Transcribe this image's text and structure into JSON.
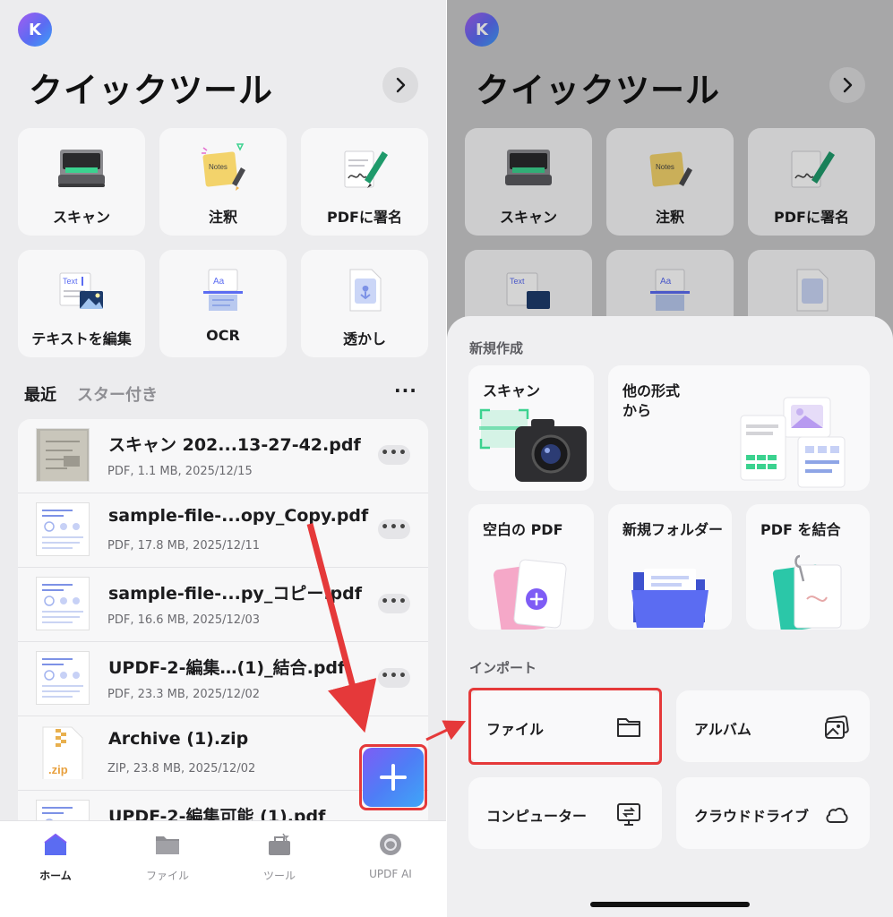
{
  "header": {
    "avatar_initial": "K",
    "title": "クイックツール"
  },
  "tools": [
    {
      "label": "スキャン",
      "icon": "scanner-icon"
    },
    {
      "label": "注釈",
      "icon": "notes-icon"
    },
    {
      "label": "PDFに署名",
      "icon": "sign-pen-icon"
    },
    {
      "label": "テキストを編集",
      "icon": "text-edit-icon"
    },
    {
      "label": "OCR",
      "icon": "ocr-icon"
    },
    {
      "label": "透かし",
      "icon": "watermark-icon"
    }
  ],
  "tool_icon_text": {
    "notes": "Notes",
    "text": "Text",
    "ocr": "Aa"
  },
  "tabs": {
    "recent": "最近",
    "starred": "スター付き",
    "more": "···"
  },
  "files": [
    {
      "name": "スキャン 202...13-27-42.pdf",
      "meta": "PDF, 1.1 MB, 2025/12/15",
      "thumb": "scan"
    },
    {
      "name": "sample-file-...opy_Copy.pdf",
      "meta": "PDF, 17.8 MB, 2025/12/11",
      "thumb": "doc"
    },
    {
      "name": "sample-file-...py_コピー.pdf",
      "meta": "PDF, 16.6 MB, 2025/12/03",
      "thumb": "doc"
    },
    {
      "name": " UPDF-2-編集…(1)_結合.pdf",
      "meta": "PDF, 23.3 MB, 2025/12/02",
      "thumb": "doc"
    },
    {
      "name": "Archive (1).zip",
      "meta": "ZIP, 23.8 MB, 2025/12/02",
      "thumb": "zip"
    },
    {
      "name": "UPDF-2-編集可能 (1).pdf",
      "meta": "",
      "thumb": "doc"
    }
  ],
  "file_more_label": "•••",
  "zip_ext": ".zip",
  "nav": [
    {
      "label": "ホーム",
      "icon": "home-icon",
      "active": true
    },
    {
      "label": "ファイル",
      "icon": "folder-icon",
      "active": false
    },
    {
      "label": "ツール",
      "icon": "toolbox-icon",
      "active": false
    },
    {
      "label": "UPDF AI",
      "icon": "ai-icon",
      "active": false
    }
  ],
  "sheet": {
    "create_title": "新規作成",
    "create_items": [
      {
        "label": "スキャン",
        "icon": "camera-icon"
      },
      {
        "label": "他の形式\nから",
        "icon": "convert-icon"
      },
      {
        "label": "空白の PDF",
        "icon": "blank-pdf-icon"
      },
      {
        "label": "新規フォルダー",
        "icon": "new-folder-icon"
      },
      {
        "label": "PDF を結合",
        "icon": "merge-pdf-icon"
      }
    ],
    "import_title": "インポート",
    "import_items": [
      {
        "label": "ファイル",
        "icon": "folder-outline-icon"
      },
      {
        "label": "アルバム",
        "icon": "album-icon"
      },
      {
        "label": "コンピューター",
        "icon": "computer-icon"
      },
      {
        "label": "クラウドドライブ",
        "icon": "cloud-icon"
      }
    ]
  },
  "colors": {
    "accent": "#5b6cf2",
    "highlight": "#e5393a",
    "background": "#ececee",
    "tile": "#f7f7f8"
  }
}
